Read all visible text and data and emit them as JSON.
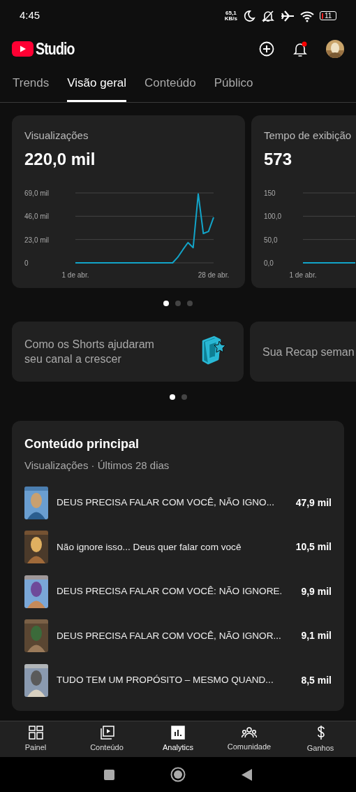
{
  "status_bar": {
    "time": "4:45",
    "net_speed": "65,1",
    "net_unit": "KB/s",
    "battery": "11"
  },
  "header": {
    "logo_text": "Studio",
    "notification_dot": true
  },
  "tabs": [
    {
      "label": "Trends",
      "selected": false
    },
    {
      "label": "Visão geral",
      "selected": true
    },
    {
      "label": "Conteúdo",
      "selected": false
    },
    {
      "label": "Público",
      "selected": false
    }
  ],
  "metric_cards": [
    {
      "title": "Visualizações",
      "value": "220,0 mil",
      "chart_data": {
        "type": "line",
        "x": [
          1,
          2,
          3,
          4,
          5,
          6,
          7,
          8,
          9,
          10,
          11,
          12,
          13,
          14,
          15,
          16,
          17,
          18,
          19,
          20,
          21,
          22,
          23,
          24,
          25,
          26,
          27,
          28
        ],
        "xlim": [
          1,
          28
        ],
        "ylim": [
          0,
          69
        ],
        "xticks": [
          {
            "value": 1,
            "label": "1 de abr."
          },
          {
            "value": 28,
            "label": "28 de abr."
          }
        ],
        "yticks": [
          {
            "value": 69,
            "label": "69,0 mil"
          },
          {
            "value": 46,
            "label": "46,0 mil"
          },
          {
            "value": 23,
            "label": "23,0 mil"
          },
          {
            "value": 0,
            "label": "0"
          }
        ],
        "series": [
          {
            "color": "#12a4c8",
            "values": [
              0,
              0,
              0,
              0,
              0,
              0,
              0,
              0,
              0,
              0,
              0,
              0,
              0,
              0,
              0,
              0,
              0,
              0,
              0,
              0,
              5.6,
              13,
              20,
              15,
              68,
              29,
              31,
              45
            ]
          }
        ]
      }
    },
    {
      "title": "Tempo de exibição",
      "value": "573",
      "chart_data": {
        "type": "line",
        "categories": [
          "1 de abr.",
          null,
          null,
          null,
          null,
          null,
          null,
          null,
          null
        ],
        "ylim": [
          0,
          150
        ],
        "yticks": [
          {
            "value": 150,
            "label": "150"
          },
          {
            "value": 100,
            "label": "100,0"
          },
          {
            "value": 50,
            "label": "50,0"
          },
          {
            "value": 0,
            "label": "0,0"
          }
        ],
        "series": [
          {
            "color": "#12a4c8",
            "values": [
              0,
              0,
              0,
              0,
              0,
              0,
              0,
              0,
              0
            ]
          }
        ]
      }
    }
  ],
  "metric_dots": [
    {
      "selected": true
    },
    {
      "selected": false
    },
    {
      "selected": false
    }
  ],
  "insight_cards": [
    {
      "kind": "tip",
      "text": "Como os Shorts ajudaram seu canal a crescer"
    },
    {
      "kind": "recap",
      "text": "Sua Recap seman"
    }
  ],
  "insight_dots": [
    {
      "selected": true
    },
    {
      "selected": false
    }
  ],
  "top_content": {
    "title": "Conteúdo principal",
    "subtitle": "Visualizações · Últimos 28 dias",
    "items": [
      {
        "title": "DEUS PRECISA FALAR COM VOCÊ, NÃO IGNO...",
        "views": "47,9 mil"
      },
      {
        "title": "Não ignore isso... Deus quer falar com você",
        "views": "10,5 mil"
      },
      {
        "title": "DEUS PRECISA FALAR COM VOCÊ: NÃO IGNORE.",
        "views": "9,9 mil"
      },
      {
        "title": "DEUS PRECISA FALAR COM VOCÊ, NÃO IGNOR...",
        "views": "9,1 mil"
      },
      {
        "title": "TUDO TEM UM PROPÓSITO – MESMO QUAND...",
        "views": "8,5 mil"
      }
    ]
  },
  "bottom_nav": [
    {
      "label": "Painel",
      "selected": false
    },
    {
      "label": "Conteúdo",
      "selected": false
    },
    {
      "label": "Analytics",
      "selected": true
    },
    {
      "label": "Comunidade",
      "selected": false
    },
    {
      "label": "Ganhos",
      "selected": false
    }
  ]
}
